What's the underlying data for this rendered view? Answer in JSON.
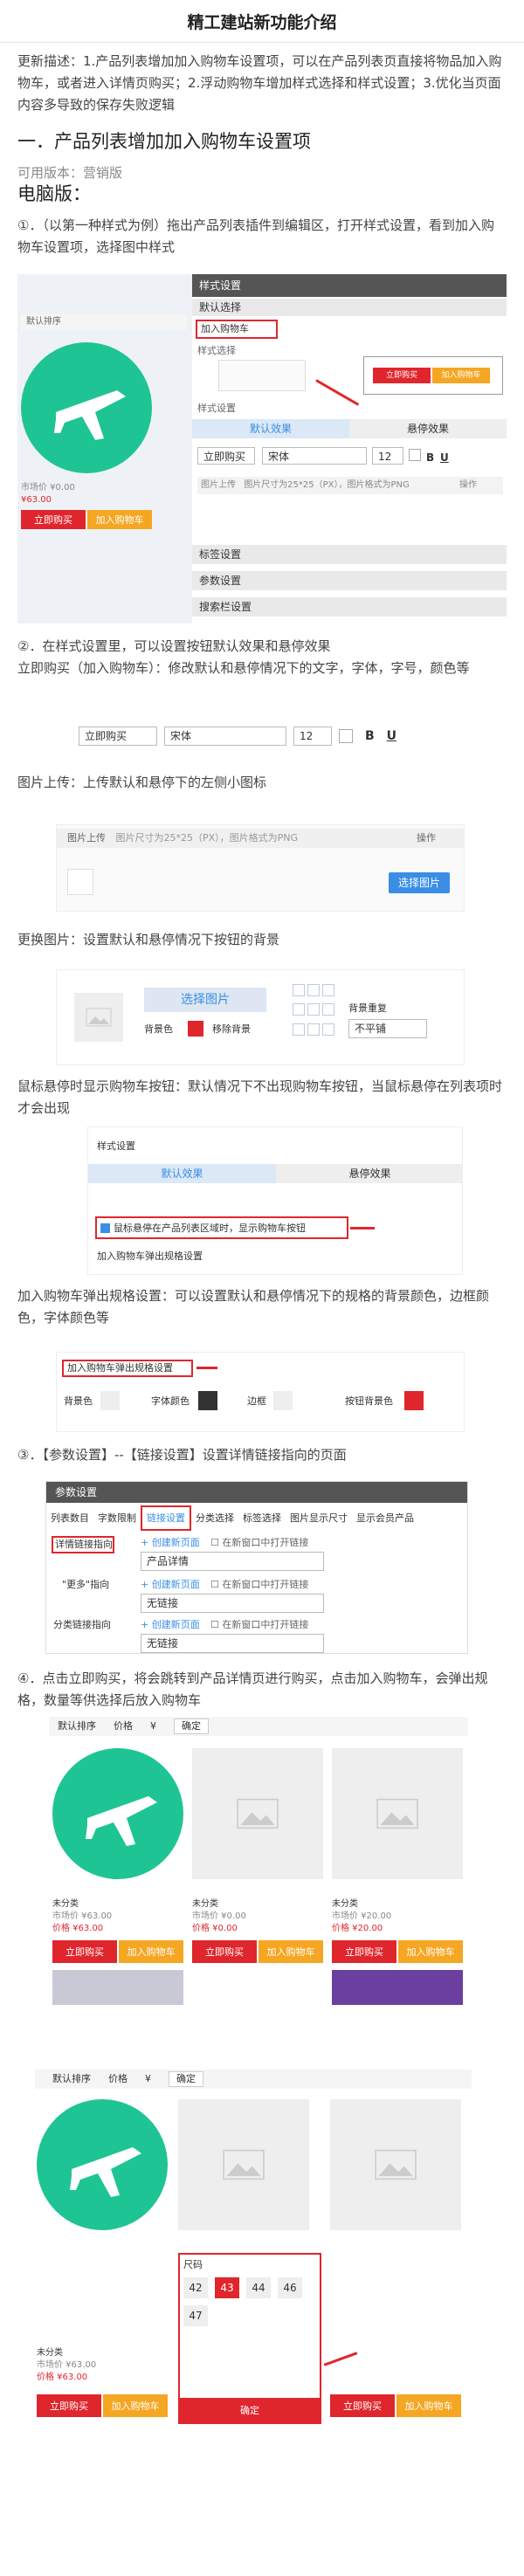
{
  "title": "精工建站新功能介绍",
  "intro": "更新描述：1.产品列表增加加入购物车设置项，可以在产品列表页直接将物品加入购物车，或者进入详情页购买；2.浮动购物车增加样式选择和样式设置；3.优化当页面内容多导致的保存失败逻辑",
  "section1": {
    "heading": "一．产品列表增加加入购物车设置项",
    "version": "可用版本：营销版",
    "pc": "电脑版：",
    "step1": "①．（以第一种样式为例）拖出产品列表插件到编辑区，打开样式设置，看到加入购物车设置项，选择图中样式",
    "step2": "②．在样式设置里，可以设置按钮默认效果和悬停效果",
    "buy_desc": "立即购买（加入购物车）：修改默认和悬停情况下的文字，字体，字号，颜色等",
    "img_desc": "图片上传：上传默认和悬停下的左侧小图标",
    "bg_desc": "更换图片：设置默认和悬停情况下按钮的背景",
    "hover_desc": "鼠标悬停时显示购物车按钮：默认情况下不出现购物车按钮，当鼠标悬停在列表项时才会出现",
    "spec_desc": "加入购物车弹出规格设置：可以设置默认和悬停情况下的规格的背景颜色，边框颜色，字体颜色等",
    "step3": "③．【参数设置】--【链接设置】设置详情链接指向的页面",
    "step4": "④．点击立即购买，将会跳转到产品详情页进行购买，点击加入购物车，会弹出规格，数量等供选择后放入购物车"
  },
  "shot1": {
    "panel_title": "样式设置",
    "default_select": "默认选择",
    "add_cart": "加入购物车",
    "style_select": "样式选择",
    "btn_buy": "立即购买",
    "btn_cart": "加入购物车",
    "tab_default": "默认效果",
    "tab_hover": "悬停效果",
    "buy_input": "立即购买",
    "font": "宋体",
    "size": "12",
    "upload_label": "图片上传",
    "upload_hint": "图片尺寸为25*25（PX），图片格式为PNG",
    "op": "操作",
    "sec_a": "标签设置",
    "sec_b": "参数设置",
    "sec_c": "搜索栏设置",
    "default_sort": "默认排序",
    "price_old": "市场价 ¥0.00",
    "price_new": "¥63.00"
  },
  "shot2": {
    "buy_input": "立即购买",
    "font": "宋体",
    "size": "12"
  },
  "shot3": {
    "label": "图片上传",
    "hint": "图片尺寸为25*25（PX），图片格式为PNG",
    "op": "操作",
    "btn": "选择图片"
  },
  "shot4": {
    "btn": "选择图片",
    "bg_color": "背景色",
    "remove_bg": "移除背景",
    "repeat": "背景重复",
    "repeat_val": "不平铺"
  },
  "shot5": {
    "title": "样式设置",
    "tab_default": "默认效果",
    "tab_hover": "悬停效果",
    "checkbox": "鼠标悬停在产品列表区域时，显示购物车按钮",
    "spec": "加入购物车弹出规格设置"
  },
  "shot6": {
    "spec": "加入购物车弹出规格设置",
    "bg": "背景色",
    "font_color": "字体颜色",
    "border": "边框",
    "btn_bg": "按钮背景色"
  },
  "shot7": {
    "title": "参数设置",
    "tabs": [
      "列表数目",
      "字数限制",
      "链接设置",
      "分类选择",
      "标签选择",
      "图片显示尺寸",
      "显示会员产品"
    ],
    "detail_link": "详情链接指向",
    "more_link": "\"更多\"指向",
    "cat_link": "分类链接指向",
    "new_page": "创建新页面",
    "new_window": "在新窗口中打开链接",
    "detail_val": "产品详情",
    "none_val": "无链接"
  },
  "shot8": {
    "sort": "默认排序",
    "price": "价格",
    "yen": "¥",
    "confirm": "确定",
    "item_name": "未分类",
    "old1": "市场价 ¥63.00",
    "new1": "价格 ¥63.00",
    "old2": "市场价 ¥0.00",
    "new2": "价格 ¥0.00",
    "old3": "市场价 ¥20.00",
    "new3": "价格 ¥20.00",
    "buy": "立即购买",
    "cart": "加入购物车"
  },
  "shot9": {
    "sort": "默认排序",
    "price": "价格",
    "yen": "¥",
    "confirm_top": "确定",
    "size_label": "尺码",
    "sizes": [
      "42",
      "43",
      "44",
      "46",
      "47"
    ],
    "confirm": "确定",
    "item_name": "未分类",
    "old1": "市场价 ¥63.00",
    "new1": "价格 ¥63.00",
    "buy": "立即购买",
    "cart": "加入购物车"
  },
  "colors": {
    "red": "#e0262d",
    "orange": "#f5a623",
    "blue": "#3a8ee6",
    "green": "#1fc494"
  }
}
